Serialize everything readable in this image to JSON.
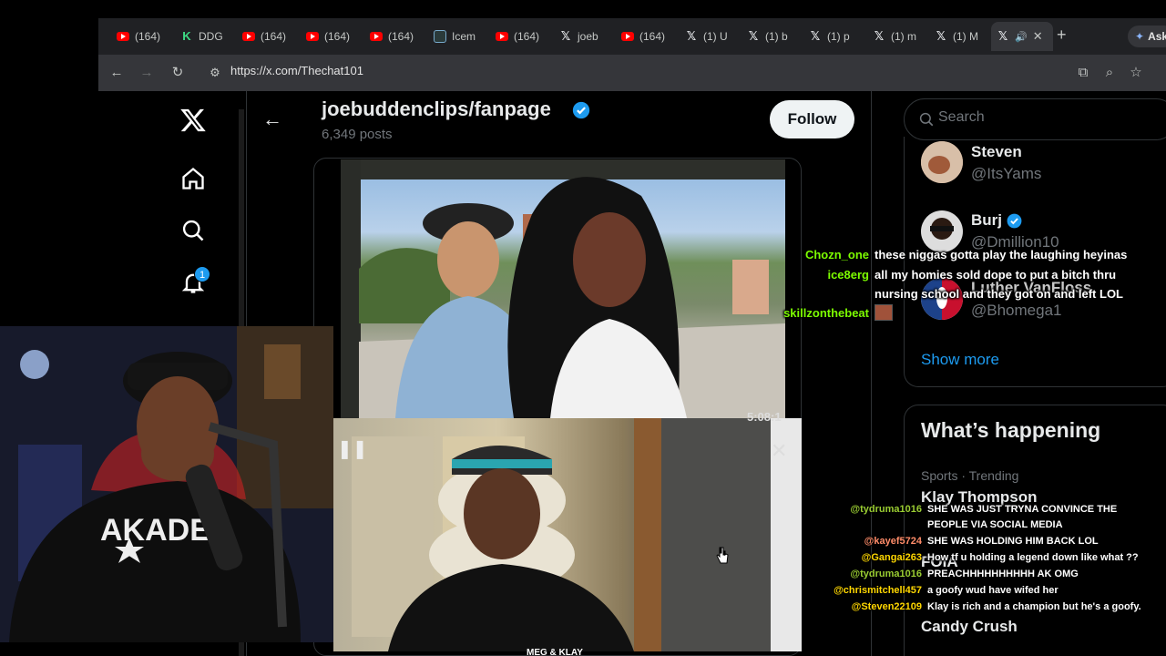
{
  "browser": {
    "tabs": [
      {
        "icon": "youtube-icon",
        "label": "(164)"
      },
      {
        "icon": "ddg-icon",
        "label": "DDG"
      },
      {
        "icon": "youtube-icon",
        "label": "(164)"
      },
      {
        "icon": "youtube-icon",
        "label": "(164)"
      },
      {
        "icon": "youtube-icon",
        "label": "(164)"
      },
      {
        "icon": "ice-icon",
        "label": "Icem"
      },
      {
        "icon": "youtube-icon",
        "label": "(164)"
      },
      {
        "icon": "x-icon",
        "label": "joeb"
      },
      {
        "icon": "youtube-icon",
        "label": "(164)"
      },
      {
        "icon": "x-icon",
        "label": "(1) U"
      },
      {
        "icon": "x-icon",
        "label": "(1) b"
      },
      {
        "icon": "x-icon",
        "label": "(1) p"
      },
      {
        "icon": "x-icon",
        "label": "(1) m"
      },
      {
        "icon": "x-icon",
        "label": "(1) M"
      }
    ],
    "active_tab_icon": "x-icon",
    "new_tab_symbol": "+",
    "ask_label": "Ask",
    "url": "https://x.com/Thechat101"
  },
  "profile": {
    "name": "joebuddenclips/fanpage",
    "posts": "6,349 posts",
    "follow_label": "Follow"
  },
  "notifications_badge": "1",
  "video": {
    "timestamp": "5:08:1",
    "caption": "MEG & KLAY"
  },
  "search": {
    "placeholder": "Search"
  },
  "who_to_follow": {
    "accounts": [
      {
        "name": "Steven",
        "handle": "@ItsYams",
        "verified": false
      },
      {
        "name": "Burj",
        "handle": "@Dmillion10",
        "verified": true
      },
      {
        "name": "Luther VanFloss",
        "handle": "@Bhomega1",
        "verified": false
      }
    ],
    "show_more": "Show more"
  },
  "trending": {
    "title": "What’s happening",
    "items": [
      {
        "category": "Sports · Trending",
        "name": "Klay Thompson"
      },
      {
        "category": "",
        "name": "FOIA"
      },
      {
        "category": "",
        "name": "Candy Crush"
      }
    ]
  },
  "chat_top": [
    {
      "user": "Chozn_one",
      "color": "#7CFC00",
      "message": "these niggas gotta play the laughing heyinas"
    },
    {
      "user": "ice8erg",
      "color": "#7CFC00",
      "message": "all my homies sold dope to put a bitch thru"
    },
    {
      "user": "",
      "color": "#7CFC00",
      "message": "nursing school and they got on and left LOL"
    },
    {
      "user": "skillzonthebeat",
      "color": "#7CFC00",
      "message": ""
    }
  ],
  "chat_bottom": [
    {
      "user": "@tydruma1016",
      "color": "#9ACD32",
      "message": "SHE WAS JUST TRYNA CONVINCE THE"
    },
    {
      "user": "",
      "color": "#9ACD32",
      "message": "PEOPLE VIA SOCIAL MEDIA"
    },
    {
      "user": "@kayef5724",
      "color": "#FF8C69",
      "message": "SHE WAS HOLDING HIM BACK LOL"
    },
    {
      "user": "@Gangai263",
      "color": "#FFD700",
      "message": "How tf u holding a legend down like what ??"
    },
    {
      "user": "@tydruma1016",
      "color": "#9ACD32",
      "message": "PREACHHHHHHHHHH AK OMG"
    },
    {
      "user": "@chrismitchell457",
      "color": "#FFD700",
      "message": "a goofy wud have wifed her"
    },
    {
      "user": "@Steven22109",
      "color": "#FFD700",
      "message": "Klay is rich and a champion but he's a goofy."
    }
  ],
  "colors": {
    "x_blue": "#1d9bf0",
    "background": "#000000",
    "text_secondary": "#71767b"
  }
}
